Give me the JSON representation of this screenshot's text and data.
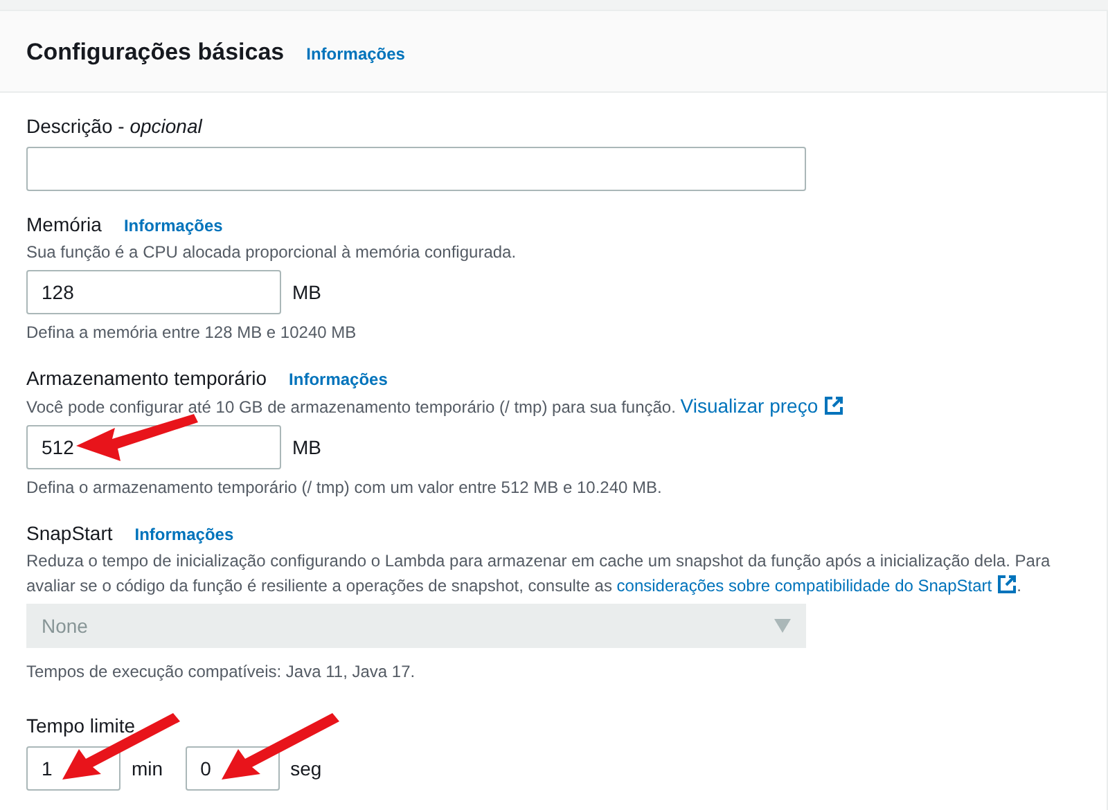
{
  "header": {
    "title": "Configurações básicas",
    "info": "Informações"
  },
  "fields": [
    {
      "kind": "text",
      "label": "Descrição - *opcional*"
    },
    {
      "kind": "unit",
      "label": "Memória",
      "info": "Informações",
      "description": "Sua função é a CPU alocada proporcional à memória configurada.",
      "value": "128",
      "unit": "MB",
      "hint": "Defina a memória entre 128 MB e 10240 MB",
      "arrow": false
    },
    {
      "kind": "unit",
      "label": "Armazenamento temporário",
      "info": "Informações",
      "description": "Você pode configurar até 10 GB de armazenamento temporário (/ tmp) para sua função.",
      "link": "Visualizar preço",
      "value": "512",
      "unit": "MB",
      "hint": "Defina o armazenamento temporário (/ tmp) com um valor entre 512 MB e 10.240 MB.",
      "arrow": true
    },
    {
      "kind": "select",
      "label": "SnapStart",
      "info": "Informações",
      "description": "Reduza o tempo de inicialização configurando o Lambda para armazenar em cache um snapshot da função após a inicialização dela. Para avaliar se o código da função é resiliente a operações de snapshot, consulte as",
      "link": "considerações sobre compatibilidade do SnapStart",
      "link_suffix": ".",
      "value": "None",
      "disabled": true,
      "hint": "Tempos de execução compatíveis: Java 11, Java 17."
    },
    {
      "kind": "time",
      "label": "Tempo limite",
      "parts": [
        {
          "value": "1",
          "unit": "min",
          "arrow": true
        },
        {
          "value": "0",
          "unit": "seg",
          "arrow": true
        }
      ]
    }
  ]
}
